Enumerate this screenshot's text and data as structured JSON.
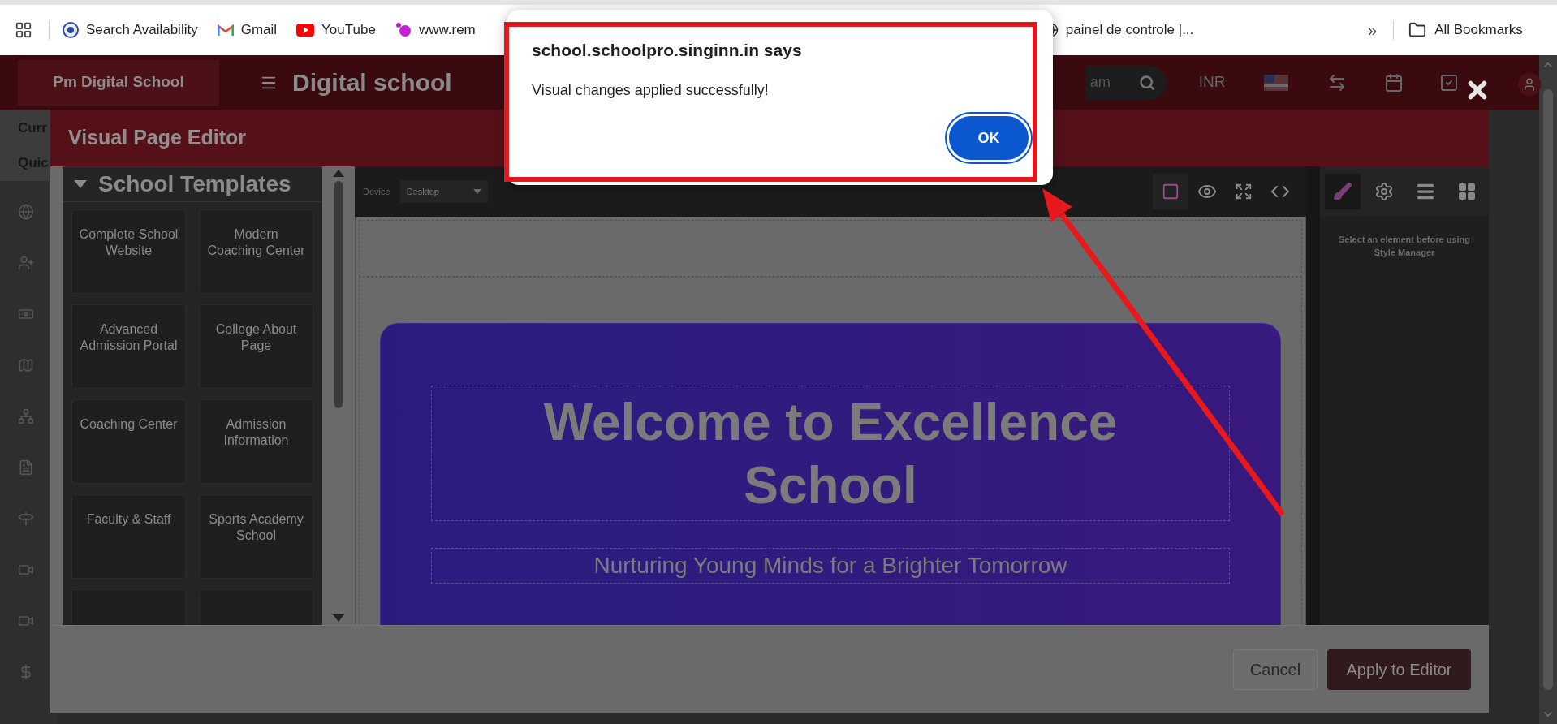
{
  "bookmarks": [
    {
      "label": "Search Availability",
      "kind": "seal"
    },
    {
      "label": "Gmail",
      "kind": "mail"
    },
    {
      "label": "YouTube",
      "kind": "play"
    },
    {
      "label": "www.rem",
      "kind": "dots"
    },
    {
      "label": "painel de controle |...",
      "kind": "globe"
    }
  ],
  "bookmarks_more": "»",
  "all_bookmarks": "All Bookmarks",
  "site_header": {
    "logo": "Pm Digital School",
    "title": "Digital school",
    "search_value": "am",
    "currency": "INR"
  },
  "sidebar": {
    "headings": [
      "Curr",
      "Quic"
    ],
    "items": [
      {
        "kind": "globe"
      },
      {
        "kind": "user-plus"
      },
      {
        "kind": "money"
      },
      {
        "kind": "map"
      },
      {
        "kind": "network"
      },
      {
        "kind": "file"
      },
      {
        "kind": "signpost"
      },
      {
        "kind": "video"
      },
      {
        "kind": "video"
      },
      {
        "kind": "dollar"
      }
    ]
  },
  "editor": {
    "title": "Visual Page Editor",
    "category": {
      "title": "School Templates",
      "expanded": true
    },
    "templates": [
      "Complete School Website",
      "Modern Coaching Center",
      "Advanced Admission Portal",
      "College About Page",
      "Coaching Center",
      "Admission Information",
      "Faculty & Staff",
      "Sports Academy School"
    ],
    "device_label": "Device",
    "device": "Desktop",
    "view_tools": [
      {
        "kind": "square",
        "selected": true
      },
      {
        "kind": "eye",
        "selected": false
      },
      {
        "kind": "expand",
        "selected": false
      },
      {
        "kind": "code",
        "selected": false
      }
    ],
    "panel_tabs": [
      {
        "kind": "brush",
        "selected": true
      },
      {
        "kind": "gear",
        "selected": false
      },
      {
        "kind": "layers",
        "selected": false
      },
      {
        "kind": "blocks",
        "selected": false
      }
    ],
    "style_hint": "Select an element before using Style Manager",
    "hero": {
      "title": "Welcome to Excellence School",
      "subtitle": "Nurturing Young Minds for a Brighter Tomorrow"
    },
    "cancel": "Cancel",
    "apply": "Apply to Editor"
  },
  "alert": {
    "origin": "school.schoolpro.singinn.in says",
    "message": "Visual changes applied successfully!",
    "button": "OK"
  }
}
